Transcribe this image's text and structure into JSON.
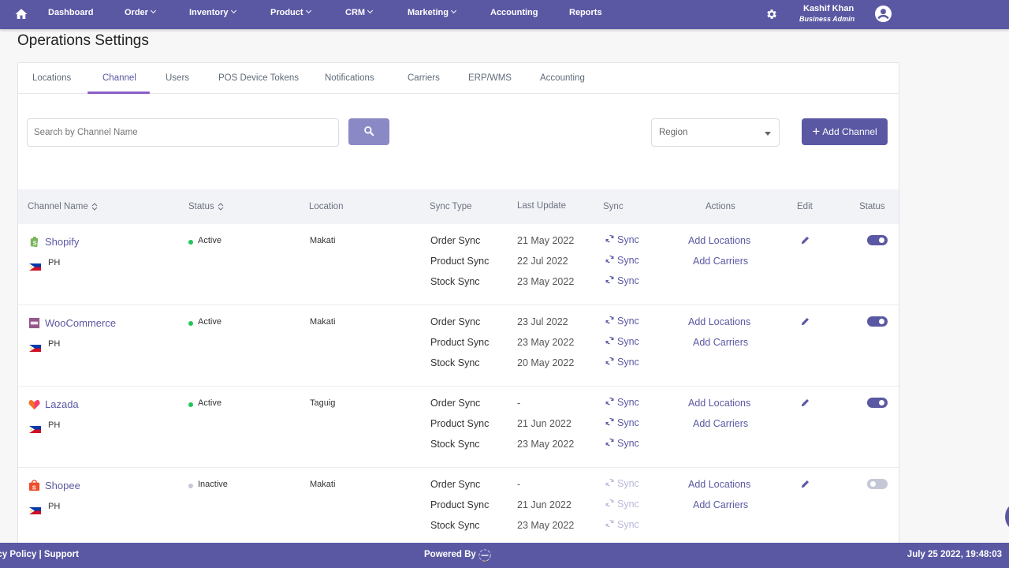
{
  "nav": {
    "home_icon": "home-icon",
    "items": [
      {
        "label": "Dashboard",
        "dropdown": false
      },
      {
        "label": "Order",
        "dropdown": true
      },
      {
        "label": "Inventory",
        "dropdown": true
      },
      {
        "label": "Product",
        "dropdown": true
      },
      {
        "label": "CRM",
        "dropdown": true
      },
      {
        "label": "Marketing",
        "dropdown": true
      },
      {
        "label": "Accounting",
        "dropdown": false
      },
      {
        "label": "Reports",
        "dropdown": false
      }
    ],
    "settings_icon": "gear-icon",
    "user": {
      "name": "Kashif Khan",
      "role": "Business Admin"
    },
    "avatar_icon": "user-circle-icon"
  },
  "page": {
    "title": "Operations Settings"
  },
  "tabs": {
    "items": [
      "Locations",
      "Channel",
      "Users",
      "POS Device Tokens",
      "Notifications",
      "Carriers",
      "ERP/WMS",
      "Accounting"
    ],
    "active": "Channel"
  },
  "toolbar": {
    "search_placeholder": "Search by Channel Name",
    "search_value": "",
    "search_icon": "search-icon",
    "region_select": {
      "selected": "Region"
    },
    "add_button": "Add Channel"
  },
  "table": {
    "headers": [
      "Channel Name",
      "Status",
      "Location",
      "Sync Type",
      "Last Update",
      "Sync",
      "Actions",
      "Edit",
      "Status"
    ],
    "rows": [
      {
        "channel": "Shopify",
        "logo": "shopify-icon",
        "region": "PH",
        "flag": "ph-flag-icon",
        "status": "Active",
        "location": "Makati",
        "syncs": [
          {
            "type": "Order Sync",
            "last_update": "21 May 2022",
            "label": "Sync"
          },
          {
            "type": "Product Sync",
            "last_update": "22 Jul 2022",
            "label": "Sync"
          },
          {
            "type": "Stock Sync",
            "last_update": "23 May 2022",
            "label": "Sync"
          }
        ],
        "actions": [
          "Add Locations",
          "Add Carriers"
        ],
        "enabled": true
      },
      {
        "channel": "WooCommerce",
        "logo": "woocommerce-icon",
        "region": "PH",
        "flag": "ph-flag-icon",
        "status": "Active",
        "location": "Makati",
        "syncs": [
          {
            "type": "Order Sync",
            "last_update": "23 Jul 2022",
            "label": "Sync"
          },
          {
            "type": "Product Sync",
            "last_update": "23 May 2022",
            "label": "Sync"
          },
          {
            "type": "Stock Sync",
            "last_update": "20 May 2022",
            "label": "Sync"
          }
        ],
        "actions": [
          "Add Locations",
          "Add Carriers"
        ],
        "enabled": true
      },
      {
        "channel": "Lazada",
        "logo": "lazada-icon",
        "region": "PH",
        "flag": "ph-flag-icon",
        "status": "Active",
        "location": "Taguig",
        "syncs": [
          {
            "type": "Order Sync",
            "last_update": "-",
            "label": "Sync"
          },
          {
            "type": "Product Sync",
            "last_update": "21 Jun 2022",
            "label": "Sync"
          },
          {
            "type": "Stock Sync",
            "last_update": "23 May 2022",
            "label": "Sync"
          }
        ],
        "actions": [
          "Add Locations",
          "Add Carriers"
        ],
        "enabled": true
      },
      {
        "channel": "Shopee",
        "logo": "shopee-icon",
        "region": "PH",
        "flag": "ph-flag-icon",
        "status": "Inactive",
        "location": "Makati",
        "syncs": [
          {
            "type": "Order Sync",
            "last_update": "-",
            "label": "Sync"
          },
          {
            "type": "Product Sync",
            "last_update": "21 Jun 2022",
            "label": "Sync"
          },
          {
            "type": "Stock Sync",
            "last_update": "23 May 2022",
            "label": "Sync"
          }
        ],
        "actions": [
          "Add Locations",
          "Add Carriers"
        ],
        "enabled": false
      }
    ]
  },
  "colors": {
    "brand": "#5a58a3",
    "active_status": "#22c55e",
    "inactive_status": "#c4c8d6",
    "tab_underline": "#8a5ec9"
  },
  "footer": {
    "links": "acy Policy | Support",
    "powered_by": "Powered By",
    "datetime": "July 25 2022, 19:48:03"
  }
}
